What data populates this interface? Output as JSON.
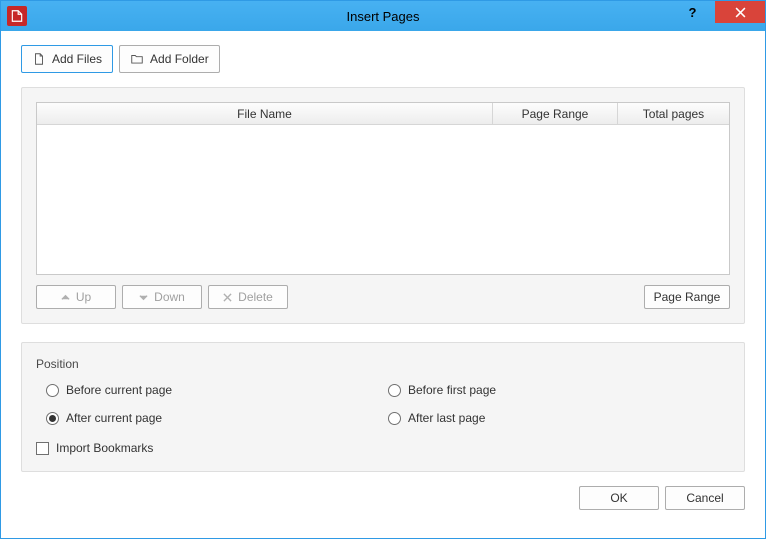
{
  "window": {
    "title": "Insert Pages"
  },
  "toolbar": {
    "add_files": "Add Files",
    "add_folder": "Add Folder"
  },
  "table": {
    "col_filename": "File Name",
    "col_pagerange": "Page Range",
    "col_totalpages": "Total pages"
  },
  "actions": {
    "up": "Up",
    "down": "Down",
    "delete": "Delete",
    "page_range": "Page Range"
  },
  "position": {
    "group_label": "Position",
    "before_current": "Before current page",
    "after_current": "After current page",
    "before_first": "Before first page",
    "after_last": "After last page",
    "selected": "after_current",
    "import_bookmarks": "Import Bookmarks",
    "import_bookmarks_checked": false
  },
  "footer": {
    "ok": "OK",
    "cancel": "Cancel"
  }
}
